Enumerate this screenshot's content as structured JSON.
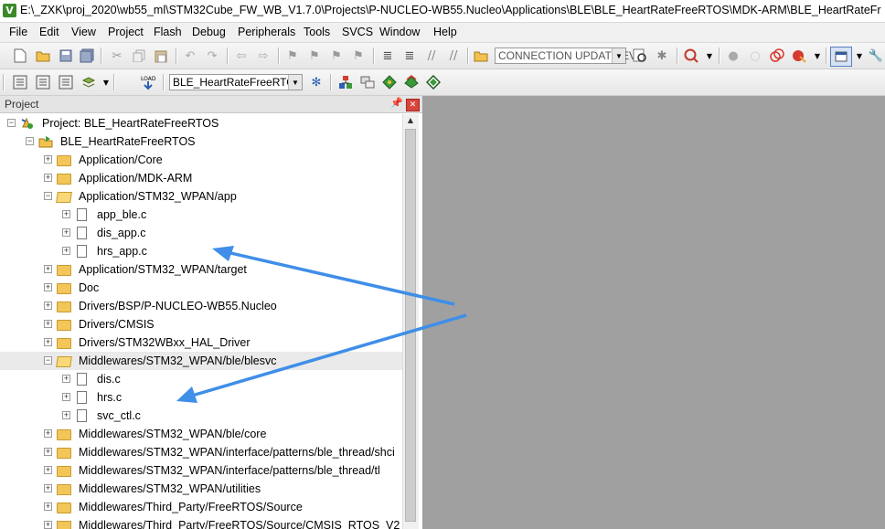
{
  "window": {
    "title": "E:\\_ZXK\\proj_2020\\wb55_ml\\STM32Cube_FW_WB_V1.7.0\\Projects\\P-NUCLEO-WB55.Nucleo\\Applications\\BLE\\BLE_HeartRateFreeRTOS\\MDK-ARM\\BLE_HeartRateFr",
    "app_icon": "V"
  },
  "menu": [
    "File",
    "Edit",
    "View",
    "Project",
    "Flash",
    "Debug",
    "Peripherals",
    "Tools",
    "SVCS",
    "Window",
    "Help"
  ],
  "toolbar": {
    "find_combo_value": "CONNECTION UPDATE EV",
    "target_combo_value": "BLE_HeartRateFreeRTOS"
  },
  "project_panel": {
    "title": "Project",
    "tree": [
      {
        "label": "Project: BLE_HeartRateFreeRTOS",
        "level": 0,
        "type": "project",
        "expander": "−"
      },
      {
        "label": "BLE_HeartRateFreeRTOS",
        "level": 1,
        "type": "target",
        "expander": "−"
      },
      {
        "label": "Application/Core",
        "level": 2,
        "type": "folder",
        "expander": "+"
      },
      {
        "label": "Application/MDK-ARM",
        "level": 2,
        "type": "folder",
        "expander": "+"
      },
      {
        "label": "Application/STM32_WPAN/app",
        "level": 2,
        "type": "folder-open",
        "expander": "−"
      },
      {
        "label": "app_ble.c",
        "level": 3,
        "type": "file",
        "expander": "+"
      },
      {
        "label": "dis_app.c",
        "level": 3,
        "type": "file",
        "expander": "+"
      },
      {
        "label": "hrs_app.c",
        "level": 3,
        "type": "file",
        "expander": "+"
      },
      {
        "label": "Application/STM32_WPAN/target",
        "level": 2,
        "type": "folder",
        "expander": "+"
      },
      {
        "label": "Doc",
        "level": 2,
        "type": "folder",
        "expander": "+"
      },
      {
        "label": "Drivers/BSP/P-NUCLEO-WB55.Nucleo",
        "level": 2,
        "type": "folder",
        "expander": "+"
      },
      {
        "label": "Drivers/CMSIS",
        "level": 2,
        "type": "folder",
        "expander": "+"
      },
      {
        "label": "Drivers/STM32WBxx_HAL_Driver",
        "level": 2,
        "type": "folder",
        "expander": "+"
      },
      {
        "label": "Middlewares/STM32_WPAN/ble/blesvc",
        "level": 2,
        "type": "folder-open",
        "expander": "−",
        "selected": true
      },
      {
        "label": "dis.c",
        "level": 3,
        "type": "file",
        "expander": "+"
      },
      {
        "label": "hrs.c",
        "level": 3,
        "type": "file",
        "expander": "+"
      },
      {
        "label": "svc_ctl.c",
        "level": 3,
        "type": "file",
        "expander": "+"
      },
      {
        "label": "Middlewares/STM32_WPAN/ble/core",
        "level": 2,
        "type": "folder",
        "expander": "+"
      },
      {
        "label": "Middlewares/STM32_WPAN/interface/patterns/ble_thread/shci",
        "level": 2,
        "type": "folder",
        "expander": "+"
      },
      {
        "label": "Middlewares/STM32_WPAN/interface/patterns/ble_thread/tl",
        "level": 2,
        "type": "folder",
        "expander": "+"
      },
      {
        "label": "Middlewares/STM32_WPAN/utilities",
        "level": 2,
        "type": "folder",
        "expander": "+"
      },
      {
        "label": "Middlewares/Third_Party/FreeRTOS/Source",
        "level": 2,
        "type": "folder",
        "expander": "+"
      },
      {
        "label": "Middlewares/Third_Party/FreeRTOS/Source/CMSIS_RTOS_V2",
        "level": 2,
        "type": "folder",
        "expander": "+"
      }
    ]
  },
  "colors": {
    "annotation_arrow": "#3f8ee8",
    "editor_background": "#a0a0a0"
  }
}
